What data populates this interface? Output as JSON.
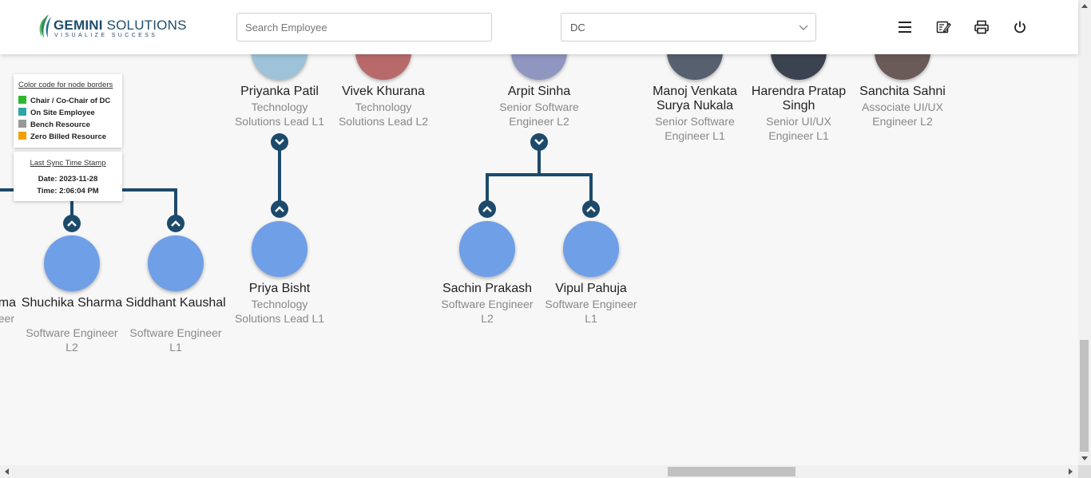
{
  "header": {
    "logo": {
      "name_bold": "GEMINI",
      "name_rest": " SOLUTIONS",
      "tagline": "VISUALIZE SUCCESS"
    },
    "search": {
      "placeholder": "Search Employee",
      "value": ""
    },
    "department_select": {
      "value": "DC"
    },
    "icons": [
      "menu-icon",
      "notes-icon",
      "print-icon",
      "power-icon"
    ]
  },
  "legend": {
    "title": "Color code for node borders",
    "items": [
      {
        "label": "Chair / Co-Chair of DC",
        "color": "#2eb82e"
      },
      {
        "label": "On Site Employee",
        "color": "#2ea5a5"
      },
      {
        "label": "Bench Resource",
        "color": "#999999"
      },
      {
        "label": "Zero Billed Resource",
        "color": "#f0a000"
      }
    ]
  },
  "sync": {
    "title": "Last Sync Time Stamp",
    "date": "Date: 2023-11-28",
    "time": "Time: 2:06:04 PM"
  },
  "colors": {
    "connector": "#1d4a6b",
    "avatar_placeholder": "#6f9fe6"
  },
  "top_row": [
    {
      "name": "Priyanka Patil",
      "role": "Technology Solutions Lead L1"
    },
    {
      "name": "Vivek Khurana",
      "role": "Technology Solutions Lead L2"
    },
    {
      "name": "Arpit Sinha",
      "role": "Senior Software Engineer L2"
    },
    {
      "name": "Manoj Venkata Surya Nukala",
      "role": "Senior Software Engineer L1"
    },
    {
      "name": "Harendra Pratap Singh",
      "role": "Senior UI/UX Engineer L1"
    },
    {
      "name": "Sanchita Sahni",
      "role": "Associate UI/UX Engineer L2"
    }
  ],
  "left_partial": {
    "name": "ma",
    "role": "eer"
  },
  "children": [
    {
      "name": "Shuchika Sharma",
      "role": "Software Engineer L2"
    },
    {
      "name": "Siddhant Kaushal",
      "role": "Software Engineer L1"
    },
    {
      "name": "Priya Bisht",
      "role": "Technology Solutions Lead L1"
    },
    {
      "name": "Sachin Prakash",
      "role": "Software Engineer L2"
    },
    {
      "name": "Vipul Pahuja",
      "role": "Software Engineer L1"
    }
  ]
}
